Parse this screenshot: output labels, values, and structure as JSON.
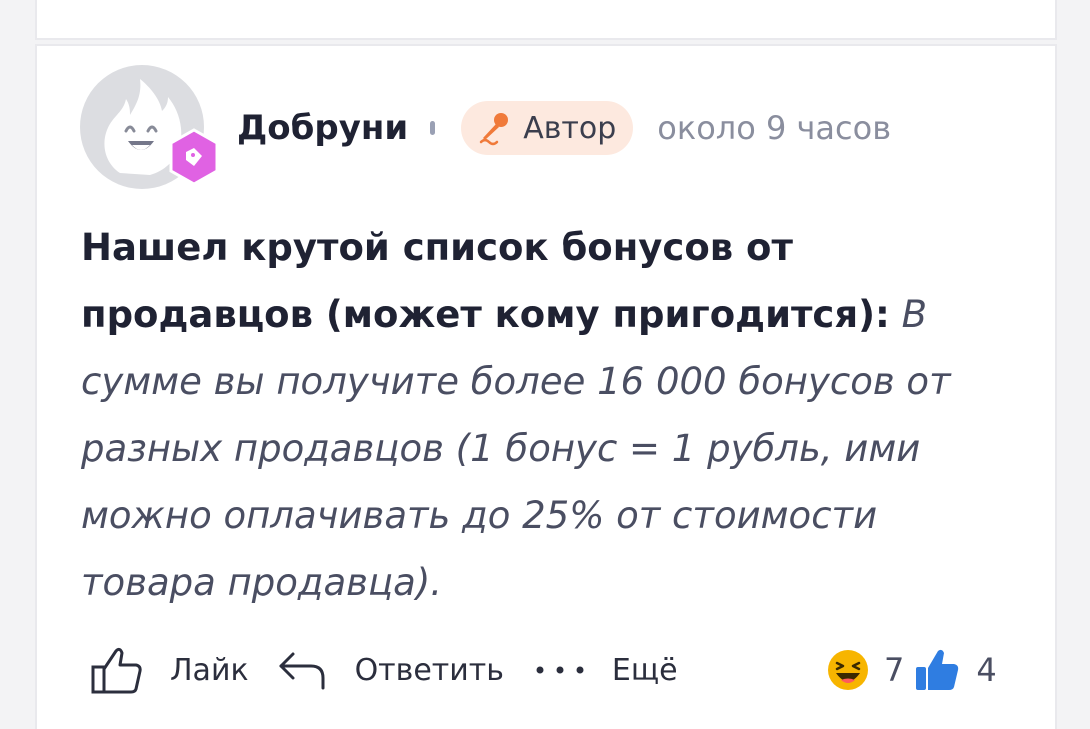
{
  "comment": {
    "author": "Добруни",
    "badge_label": "Автор",
    "time_ago": "около 9 часов",
    "text_bold": "Нашел крутой список бонусов от продавцов (может кому пригодится):",
    "text_italic": "В сумме вы получите более 16 000 бонусов от разных продавцов (1 бонус = 1 рубль, ими можно оплачивать до 25% от стоимости товара продавца)."
  },
  "actions": {
    "like_label": "Лайк",
    "reply_label": "Ответить",
    "more_label": "Ещё"
  },
  "reactions": [
    {
      "icon": "laughing-emoji-icon",
      "count": "7"
    },
    {
      "icon": "thumbs-up-icon",
      "count": "4"
    }
  ],
  "icons": {
    "avatar": "flame-mascot-avatar",
    "avatar_badge": "tag-badge-icon",
    "author_badge": "microphone-icon",
    "like": "thumb-up-outline-icon",
    "reply": "reply-arrow-icon",
    "more": "more-dots-icon"
  },
  "colors": {
    "avatar_badge": "#e062e3",
    "author_badge_bg": "#fde9df",
    "microphone": "#f07a3a",
    "thumbs_up": "#2f7de1",
    "laugh_emoji": "#f7b500"
  }
}
